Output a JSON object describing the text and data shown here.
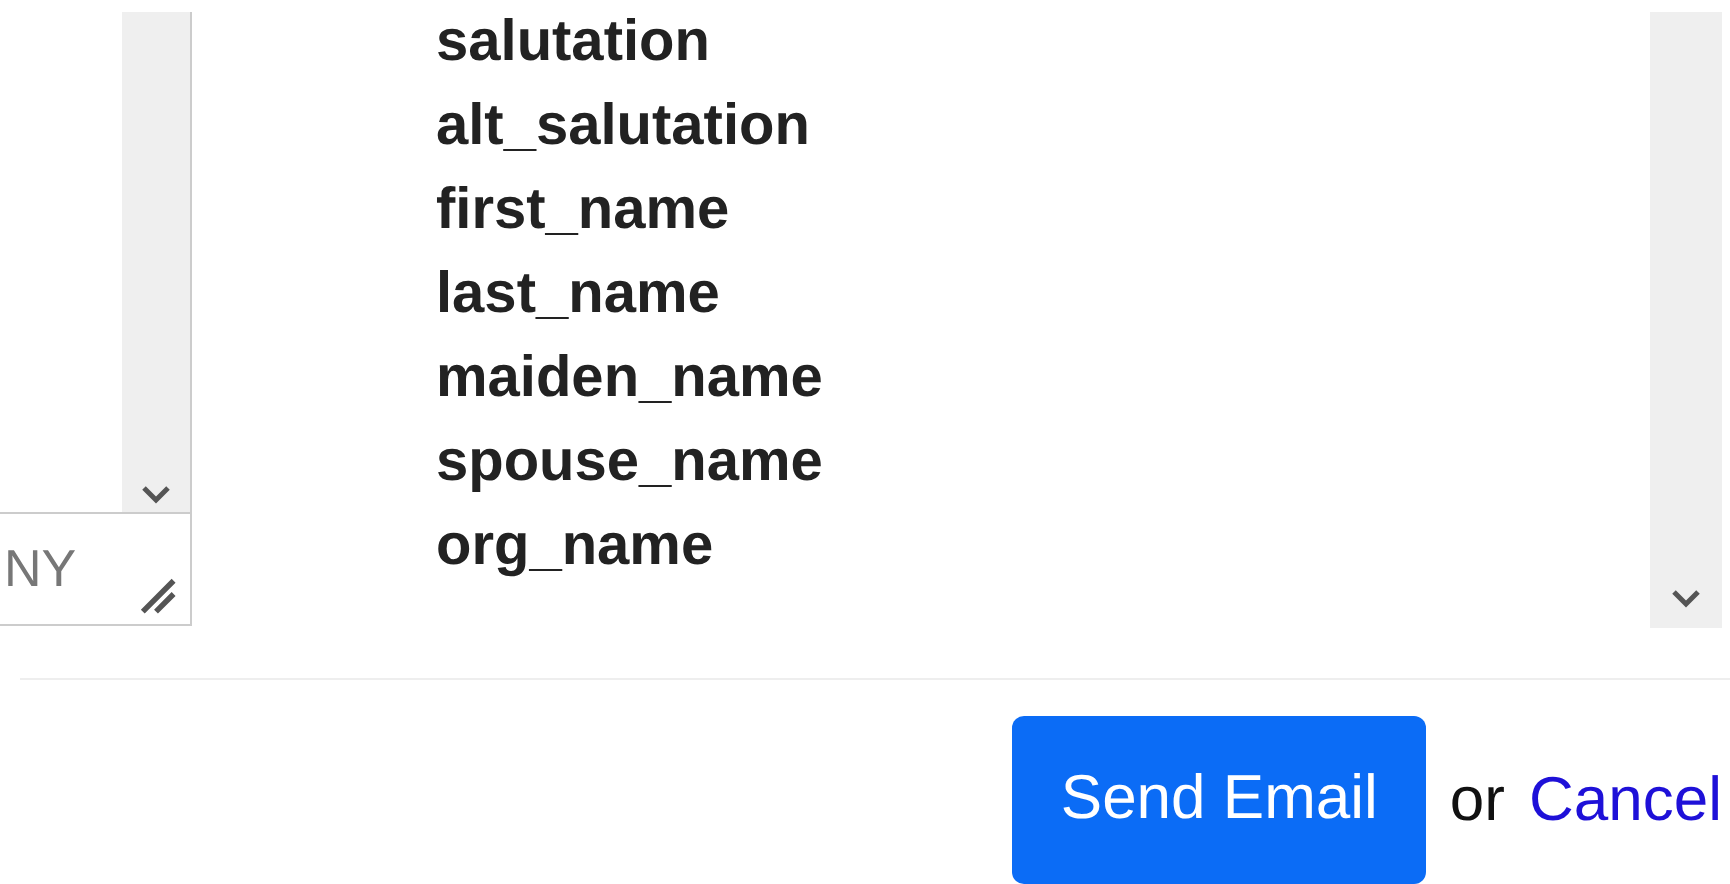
{
  "left_field": {
    "value": "NY"
  },
  "fields_list": {
    "items": [
      "salutation",
      "alt_salutation",
      "first_name",
      "last_name",
      "maiden_name",
      "spouse_name",
      "org_name"
    ]
  },
  "actions": {
    "send_button": "Send Email",
    "separator": "or",
    "cancel_link": "Cancel"
  }
}
